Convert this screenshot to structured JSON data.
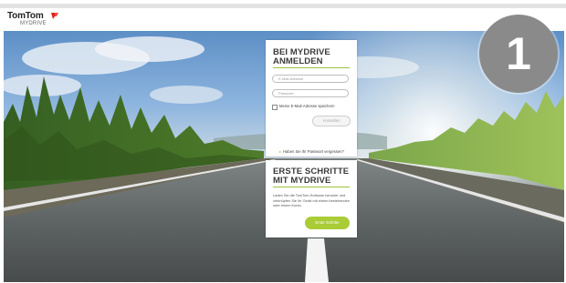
{
  "brand": {
    "name": "TomTom",
    "product": "MYDRIVE",
    "logo_color": "#e2231a"
  },
  "login_panel": {
    "title_line1": "BEI MYDRIVE",
    "title_line2": "ANMELDEN",
    "email_placeholder": "E-Mail-Adresse",
    "password_placeholder": "Passwort",
    "remember_label": "Meine E-Mail-Adresse speichern",
    "remember_checked": false,
    "login_button": "Anmelden",
    "forgot_link": "Haben Sie Ihr Passwort vergessen?"
  },
  "start_panel": {
    "title_line1": "ERSTE SCHRITTE",
    "title_line2": "MIT MYDRIVE",
    "description": "Laden Sie die TomTom-Software herunter und verknüpfen Sie Ihr Gerät mit einem bestehenden oder einem Konto.",
    "button": "Erste Schritte"
  },
  "step_badge": {
    "label": "1"
  },
  "colors": {
    "accent_green": "#a9cc37",
    "badge_gray": "#8a8a8a"
  }
}
